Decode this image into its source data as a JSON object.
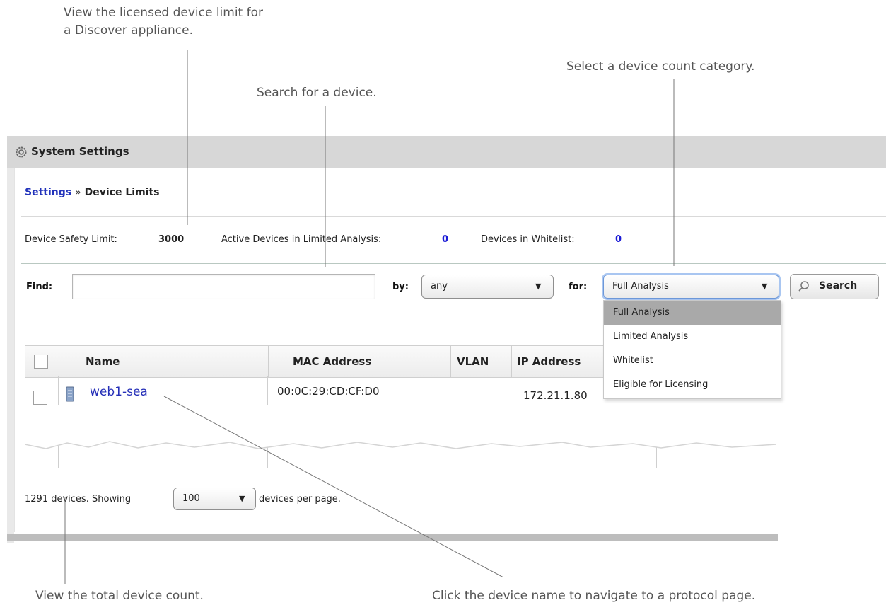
{
  "callouts": {
    "device_limit": [
      "View the licensed device limit for",
      "a Discover appliance."
    ],
    "search": "Search for a device.",
    "category": "Select a device count category.",
    "total_count": "View the total device count.",
    "device_name": "Click the device name to navigate to a protocol page."
  },
  "window": {
    "title": "System Settings",
    "icon": "gear-icon"
  },
  "breadcrumb": {
    "parent": "Settings",
    "separator": "»",
    "current": "Device Limits"
  },
  "stats": {
    "safety_limit_label": "Device Safety Limit:",
    "safety_limit_value": "3000",
    "active_limited_label": "Active Devices in Limited Analysis:",
    "active_limited_value": "0",
    "whitelist_label": "Devices in Whitelist:",
    "whitelist_value": "0"
  },
  "search": {
    "find_label": "Find:",
    "find_value": "",
    "by_label": "by:",
    "by_value": "any",
    "for_label": "for:",
    "for_value": "Full Analysis",
    "button_label": "Search",
    "button_icon": "magnifier-icon"
  },
  "for_options": [
    {
      "label": "Full Analysis",
      "selected": true
    },
    {
      "label": "Limited Analysis",
      "selected": false
    },
    {
      "label": "Whitelist",
      "selected": false
    },
    {
      "label": "Eligible for Licensing",
      "selected": false
    }
  ],
  "table": {
    "columns": [
      "Name",
      "MAC Address",
      "VLAN",
      "IP Address"
    ],
    "rows": [
      {
        "name": "web1-sea",
        "mac": "00:0C:29:CD:CF:D0",
        "vlan": "",
        "ip": "172.21.1.80",
        "icon": "server-icon"
      }
    ]
  },
  "footer": {
    "count_text": "1291 devices. Showing",
    "per_page_value": "100",
    "suffix": "devices per page."
  },
  "colors": {
    "link": "#2630b8",
    "stat_value": "#1a1ad6",
    "titlebar": "#d7d7d7",
    "selected_option": "#a9a9a9"
  }
}
